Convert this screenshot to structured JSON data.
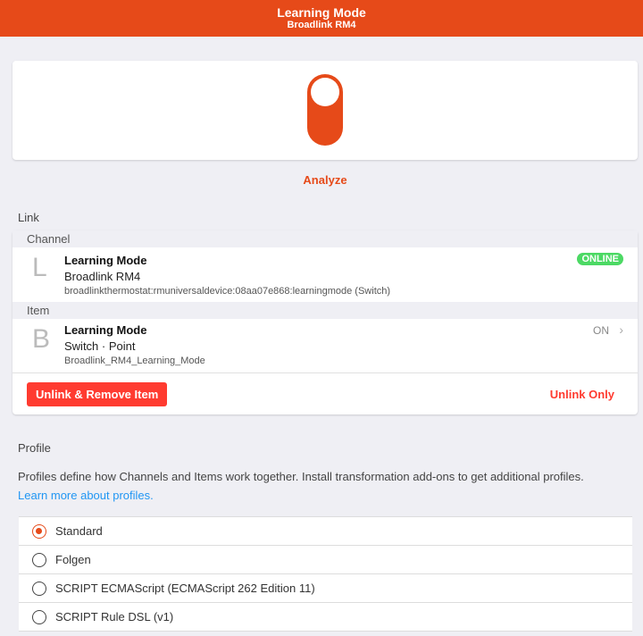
{
  "navbar": {
    "title": "Learning Mode",
    "subtitle": "Broadlink RM4"
  },
  "widget": {
    "state": "on",
    "accent": "#e64a19"
  },
  "analyze_label": "Analyze",
  "link": {
    "section_title": "Link",
    "channel_header": "Channel",
    "channel": {
      "letter": "L",
      "title": "Learning Mode",
      "subtitle": "Broadlink RM4",
      "uid": "broadlinkthermostat:rmuniversaldevice:08aa07e868:learningmode (Switch)",
      "status": "ONLINE"
    },
    "item_header": "Item",
    "item": {
      "letter": "B",
      "title": "Learning Mode",
      "subtitle": "Switch · Point",
      "name": "Broadlink_RM4_Learning_Mode",
      "state": "ON"
    },
    "unlink_remove_label": "Unlink & Remove Item",
    "unlink_only_label": "Unlink Only"
  },
  "profile": {
    "section_title": "Profile",
    "description": "Profiles define how Channels and Items work together. Install transformation add-ons to get additional profiles.",
    "learn_more": "Learn more about profiles.",
    "options": [
      {
        "label": "Standard",
        "selected": true
      },
      {
        "label": "Folgen",
        "selected": false
      },
      {
        "label": "SCRIPT ECMAScript (ECMAScript 262 Edition 11)",
        "selected": false
      },
      {
        "label": "SCRIPT Rule DSL (v1)",
        "selected": false
      }
    ]
  }
}
